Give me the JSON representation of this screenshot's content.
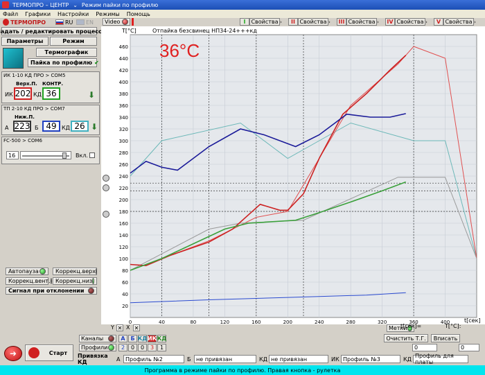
{
  "window": {
    "app": "ТЕРМОПРО – ЦЕНТР",
    "mode": "Режим пайки по профилю"
  },
  "menu": [
    "Файл",
    "Графики",
    "Настройки",
    "Режимы",
    "Помощь"
  ],
  "left": {
    "logo": "ТЕРМОПРО",
    "lang_ru": "RU",
    "lang_en": "EN",
    "edit_process": "Задать / редактировать процесс",
    "params": "Параметры",
    "mode": "Режим",
    "thermograph": "Термографик",
    "profile_solder": "Пайка по профилю",
    "ik": {
      "title": "ИК 1-10 КД ПРО  > COM5",
      "top_label": "Верх.П.",
      "ctrl_label": "КОНТР.",
      "ik_label": "ИК",
      "kd_label": "КД",
      "top_value": "202",
      "ctrl_value": "36"
    },
    "tp": {
      "title": "ТП 2-10 КД ПРО  > COM7",
      "bottom_label": "Ниж.П.",
      "a_label": "А",
      "b_label": "Б",
      "kd_label": "КД",
      "a_value": "223",
      "b_value": "49",
      "kd_value": "26"
    },
    "fc": {
      "title": "FC-500  > COM6",
      "value": "16",
      "enable": "Вкл."
    },
    "autopause": "Автопауза",
    "corr_top": "Коррекц.верх",
    "corr_vent": "Коррекц.вент.",
    "corr_bottom": "Коррекц.низ",
    "signal": "Сигнал при отклонении",
    "start": "Старт"
  },
  "top_tabs": {
    "video": "Video",
    "channels": [
      {
        "num": "I",
        "label": "Свойства",
        "color": "#22aa22"
      },
      {
        "num": "II",
        "label": "Свойства",
        "color": "#cc2222"
      },
      {
        "num": "III",
        "label": "Свойства",
        "color": "#cc2222"
      },
      {
        "num": "IV",
        "label": "Свойства",
        "color": "#cc2222"
      },
      {
        "num": "V",
        "label": "Свойства",
        "color": "#cc2222"
      }
    ]
  },
  "chart_data": {
    "type": "line",
    "title": "Отпайка безсвинец НП34-24+++кд",
    "ylabel": "T[°C]",
    "xlabel": "t[сек]",
    "big_temp": "36°C",
    "xlim": [
      0,
      440
    ],
    "ylim": [
      0,
      480
    ],
    "x_ticks": [
      0,
      40,
      80,
      120,
      160,
      200,
      240,
      280,
      320,
      360,
      400
    ],
    "y_ticks": [
      20,
      40,
      60,
      80,
      100,
      120,
      140,
      160,
      180,
      200,
      220,
      240,
      260,
      280,
      300,
      320,
      340,
      360,
      380,
      400,
      420,
      440,
      460
    ],
    "series": [
      {
        "color": "#6cb8b8",
        "points": [
          [
            0,
            240
          ],
          [
            40,
            300
          ],
          [
            140,
            330
          ],
          [
            200,
            270
          ],
          [
            240,
            300
          ],
          [
            280,
            330
          ],
          [
            360,
            300
          ],
          [
            400,
            300
          ],
          [
            440,
            100
          ]
        ]
      },
      {
        "color": "#e05050",
        "points": [
          [
            0,
            80
          ],
          [
            60,
            110
          ],
          [
            100,
            130
          ],
          [
            160,
            170
          ],
          [
            200,
            180
          ],
          [
            240,
            270
          ],
          [
            280,
            360
          ],
          [
            340,
            430
          ],
          [
            360,
            460
          ],
          [
            400,
            440
          ],
          [
            440,
            100
          ]
        ]
      },
      {
        "color": "#999999",
        "points": [
          [
            0,
            80
          ],
          [
            100,
            150
          ],
          [
            140,
            160
          ],
          [
            220,
            165
          ],
          [
            340,
            238
          ],
          [
            400,
            238
          ],
          [
            440,
            100
          ]
        ]
      },
      {
        "color": "#cc2222",
        "points": [
          [
            0,
            90
          ],
          [
            20,
            88
          ],
          [
            50,
            105
          ],
          [
            100,
            128
          ],
          [
            130,
            150
          ],
          [
            165,
            192
          ],
          [
            190,
            182
          ],
          [
            200,
            182
          ],
          [
            220,
            210
          ],
          [
            240,
            270
          ],
          [
            270,
            345
          ],
          [
            300,
            380
          ],
          [
            330,
            420
          ],
          [
            350,
            445
          ]
        ]
      },
      {
        "color": "#1a1a99",
        "points": [
          [
            0,
            245
          ],
          [
            20,
            265
          ],
          [
            40,
            255
          ],
          [
            60,
            250
          ],
          [
            100,
            290
          ],
          [
            140,
            320
          ],
          [
            170,
            310
          ],
          [
            210,
            290
          ],
          [
            240,
            310
          ],
          [
            275,
            345
          ],
          [
            305,
            340
          ],
          [
            330,
            340
          ],
          [
            350,
            346
          ]
        ]
      },
      {
        "color": "#3aa03a",
        "points": [
          [
            0,
            80
          ],
          [
            40,
            100
          ],
          [
            80,
            125
          ],
          [
            120,
            150
          ],
          [
            150,
            160
          ],
          [
            210,
            165
          ],
          [
            240,
            178
          ],
          [
            280,
            196
          ],
          [
            320,
            215
          ],
          [
            350,
            230
          ]
        ]
      },
      {
        "color": "#2a4ad0",
        "points": [
          [
            0,
            25
          ],
          [
            100,
            30
          ],
          [
            200,
            34
          ],
          [
            300,
            38
          ],
          [
            350,
            42
          ]
        ]
      }
    ],
    "ref_lines_y": [
      228,
      215,
      180
    ],
    "ref_lines_x": [
      40,
      100,
      160,
      220,
      360
    ]
  },
  "chart_controls": {
    "y_label": "Y",
    "x_label": "X",
    "channels": "Каналы",
    "profiles": "Профили",
    "ch_a": "А",
    "ch_b": "Б",
    "ch_kd": "КД",
    "ch_ik": "ИК",
    "ch_kd2": "КД",
    "prof_nums": [
      "2",
      "0",
      "3",
      "1"
    ],
    "metki": "Метки",
    "clear": "Очистить Т.Г.",
    "enter": "Вписать",
    "t_sec_label": "t[сек]=",
    "t_val": "0",
    "t_c_label": "T[°C]:",
    "t_c_val": "0"
  },
  "binding": {
    "label": "Привязка КД",
    "a_label": "А",
    "a_value": "Профиль №2",
    "b_label": "Б",
    "b_value": "не привязан",
    "kd_label": "КД",
    "kd_value": "не привязан",
    "ik_label": "ИК",
    "ik_value": "Профиль №3",
    "kd2_label": "КД",
    "kd2_value": "Профиль для платы"
  },
  "status": "Программа в режиме пайки по профилю.   Правая кнопка - рулетка"
}
